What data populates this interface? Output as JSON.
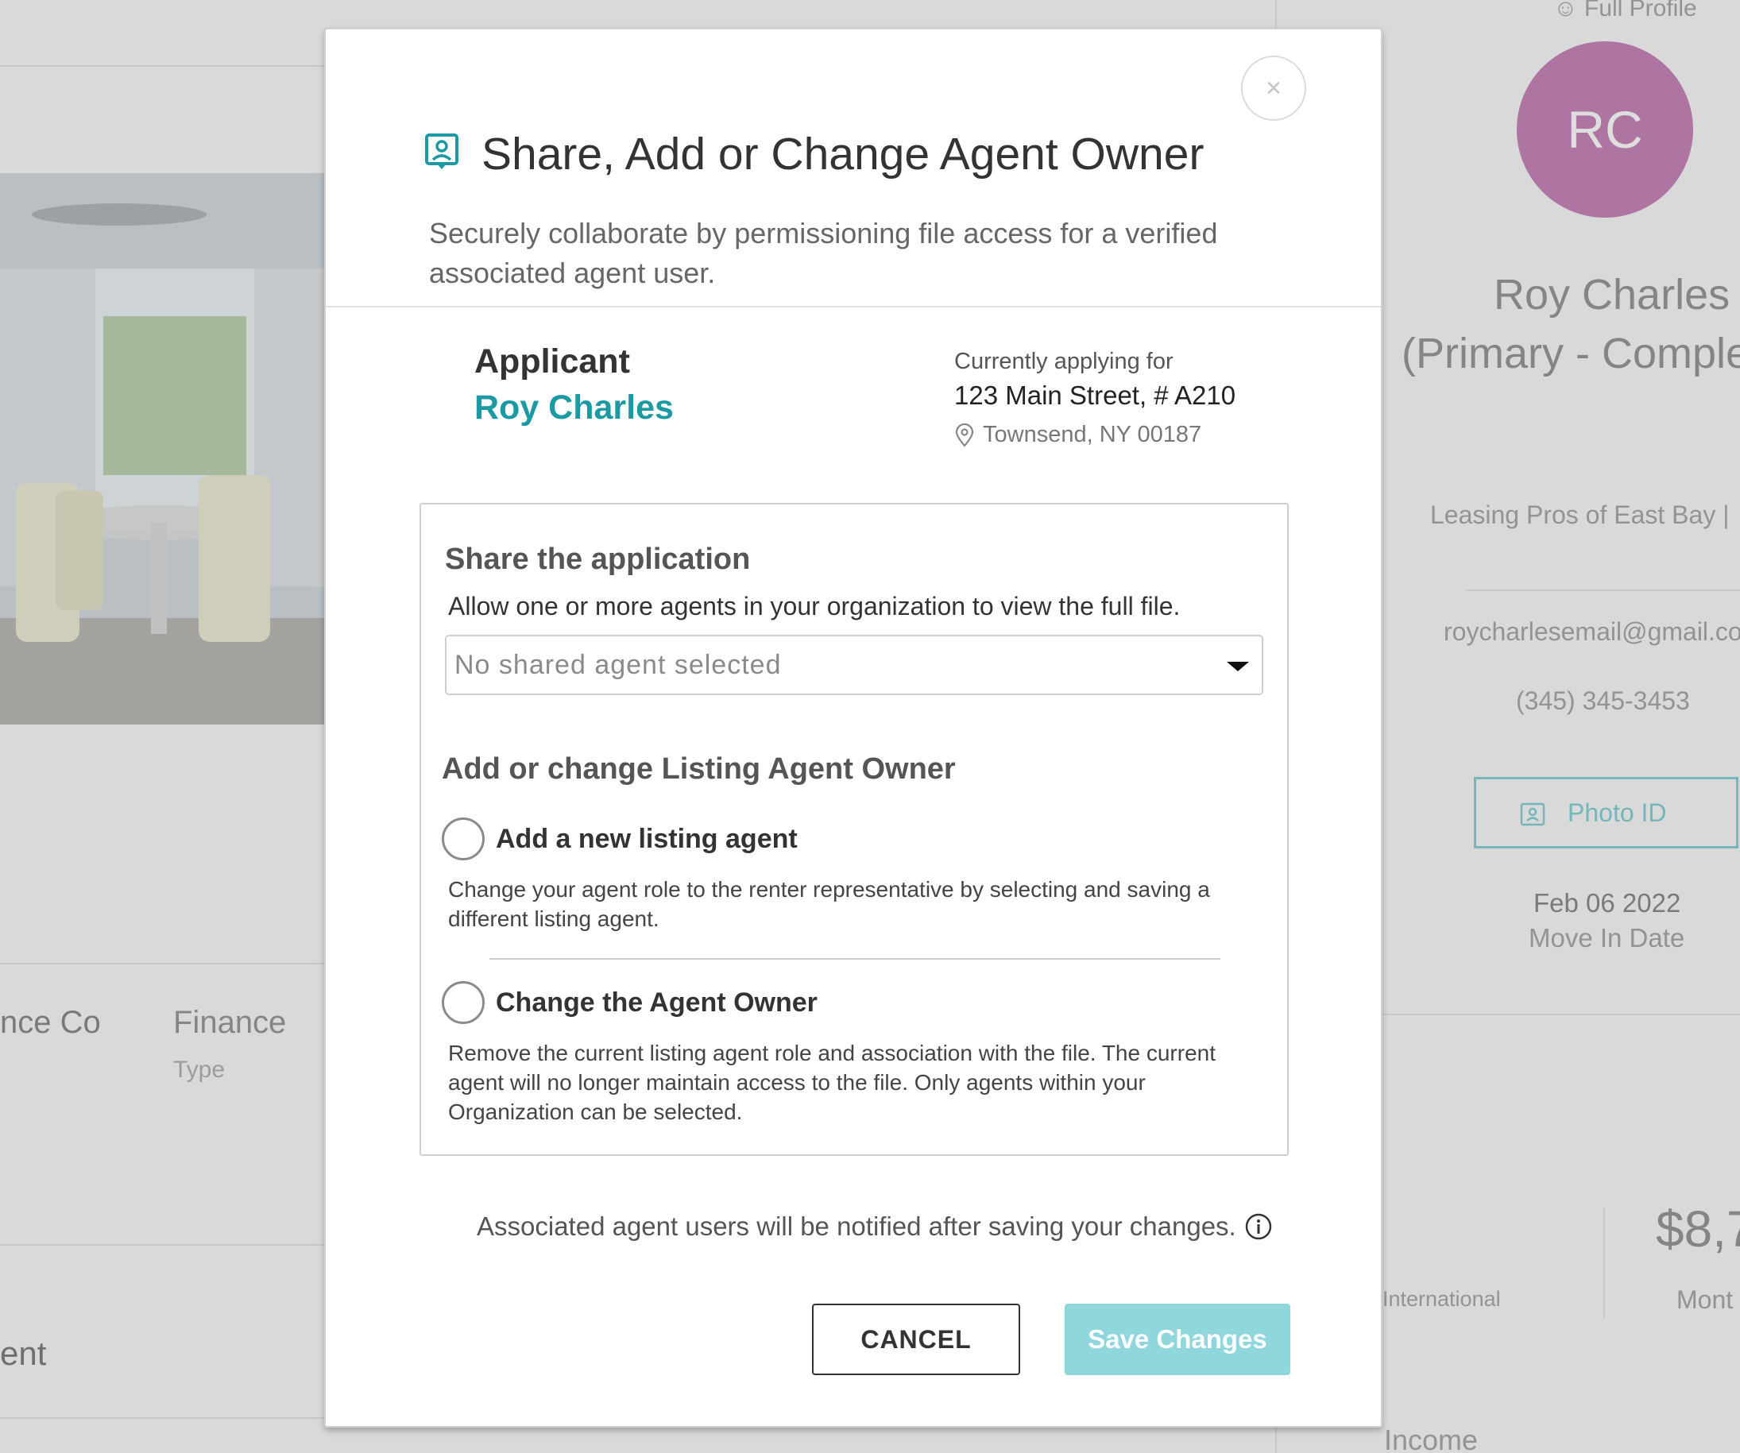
{
  "background": {
    "profile_link": "Full Profile",
    "avatar_initials": "RC",
    "applicant_name_line1": "Roy Charles",
    "applicant_name_line2": "(Primary - Comple",
    "company": "Leasing Pros of East Bay  |",
    "email": "roycharlesemail@gmail.co",
    "phone": "(345) 345-3453",
    "photo_id_label": "Photo ID",
    "move_in_date": "Feb 06 2022",
    "move_in_label": "Move In Date",
    "employer_fragment": "nce Co",
    "finance_value": "Finance",
    "finance_label": "Type",
    "income_fragment": "ent",
    "international_label": "International",
    "amount_fragment": "$8,7",
    "monthly_fragment": "Mont",
    "income_label": "Income"
  },
  "modal": {
    "close_glyph": "×",
    "title": "Share, Add or Change Agent Owner",
    "subtitle": "Securely collaborate by permissioning file access for a verified associated agent user.",
    "applicant_label": "Applicant",
    "applicant_name": "Roy Charles",
    "applying_label": "Currently applying for",
    "address": "123 Main Street, # A210",
    "city": "Townsend, NY 00187",
    "share_heading": "Share the application",
    "share_desc": "Allow one or more agents in your organization to view the full file.",
    "share_placeholder": "No shared agent selected",
    "owner_heading": "Add or change Listing Agent Owner",
    "option1_label": "Add a new listing agent",
    "option1_desc": "Change your agent role to the renter representative by selecting and saving a different listing agent.",
    "option2_label": "Change the Agent Owner",
    "option2_desc": "Remove the current listing agent role and association with the file. The current agent will no longer maintain access to the file. Only agents within your Organization can be selected.",
    "notify_text": "Associated agent users will be notified after saving your changes.",
    "cancel_label": "CANCEL",
    "save_label": "Save Changes"
  },
  "colors": {
    "accent": "#1c9aa3",
    "save_button": "#8fd7dc",
    "avatar": "#b65fa5"
  },
  "icons": [
    "agent-badge-icon",
    "close-icon",
    "location-pin-icon",
    "chevron-down-icon",
    "info-icon",
    "photo-id-icon",
    "user-icon"
  ]
}
